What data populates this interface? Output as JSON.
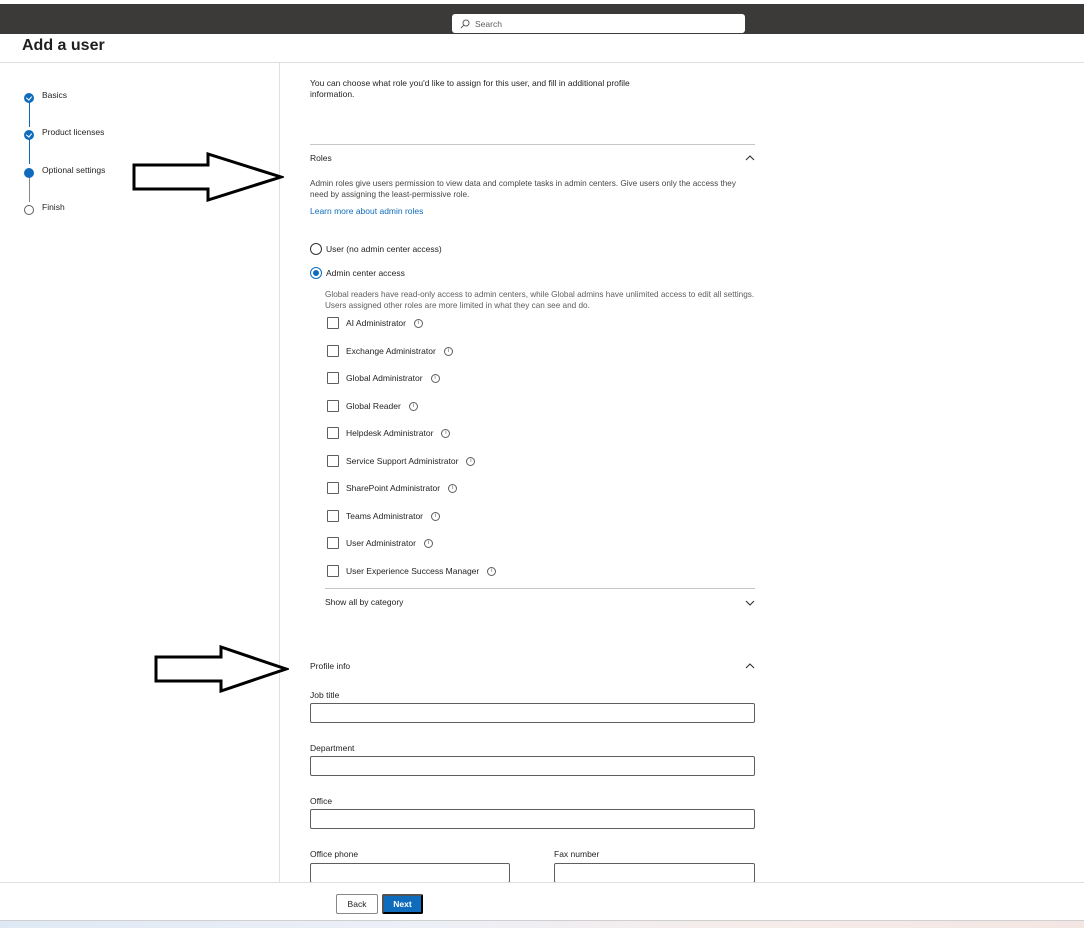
{
  "search": {
    "placeholder": "Search"
  },
  "page": {
    "title": "Add a user"
  },
  "steps": [
    {
      "label": "Basics",
      "status": "done"
    },
    {
      "label": "Product licenses",
      "status": "done"
    },
    {
      "label": "Optional settings",
      "status": "current"
    },
    {
      "label": "Finish",
      "status": "todo"
    }
  ],
  "intro": "You can choose what role you'd like to assign for this user, and fill in additional profile information.",
  "roles": {
    "heading": "Roles",
    "description": "Admin roles give users permission to view data and complete tasks in admin centers. Give users only the access they need by assigning the least-permissive role.",
    "learn_more": "Learn more about admin roles",
    "option_user": "User (no admin center access)",
    "option_admin": "Admin center access",
    "selected_option": "Admin center access",
    "admin_description": "Global readers have read-only access to admin centers, while Global admins have unlimited access to edit all settings. Users assigned other roles are more limited in what they can see and do.",
    "items": [
      "AI Administrator",
      "Exchange Administrator",
      "Global Administrator",
      "Global Reader",
      "Helpdesk Administrator",
      "Service Support Administrator",
      "SharePoint Administrator",
      "Teams Administrator",
      "User Administrator",
      "User Experience Success Manager"
    ],
    "show_all": "Show all by category"
  },
  "profile": {
    "heading": "Profile info",
    "job_title_label": "Job title",
    "department_label": "Department",
    "office_label": "Office",
    "office_phone_label": "Office phone",
    "fax_label": "Fax number"
  },
  "footer": {
    "back": "Back",
    "next": "Next"
  },
  "colors": {
    "accent": "#0f6cbd",
    "topbar": "#3b3a39"
  }
}
